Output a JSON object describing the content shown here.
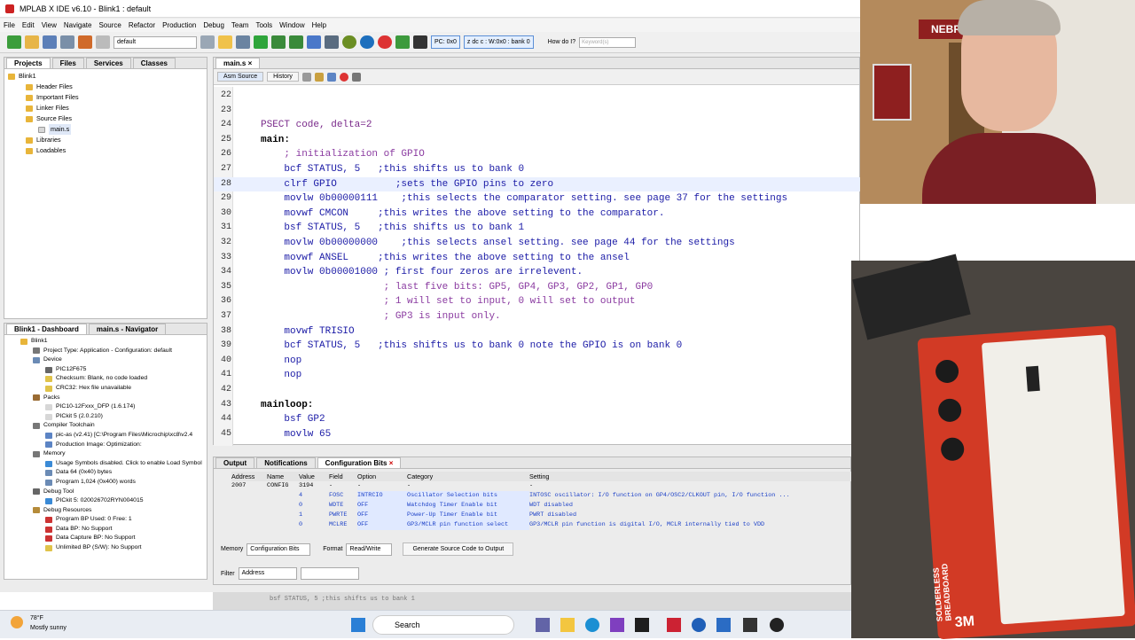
{
  "window": {
    "title": "MPLAB X IDE v6.10 - Blink1 : default"
  },
  "menu": [
    "File",
    "Edit",
    "View",
    "Navigate",
    "Source",
    "Refactor",
    "Production",
    "Debug",
    "Team",
    "Tools",
    "Window",
    "Help"
  ],
  "toolbar": {
    "config_value": "default",
    "pc": "PC: 0x0",
    "status": "z dc c : W:0x0 : bank 0",
    "howdoi": "How do I?",
    "search_placeholder": "Keyword(s)"
  },
  "projects": {
    "tabs": [
      "Projects",
      "Files",
      "Services",
      "Classes"
    ],
    "tree": [
      "Blink1",
      "Header Files",
      "Important Files",
      "Linker Files",
      "Source Files",
      "main.s",
      "Libraries",
      "Loadables"
    ]
  },
  "dashboard": {
    "tabs": [
      "Blink1 - Dashboard",
      "main.s - Navigator"
    ],
    "items": [
      "Blink1",
      "Project Type: Application - Configuration: default",
      "Device",
      "PIC12F675",
      "Checksum: Blank, no code loaded",
      "CRC32: Hex file unavailable",
      "Packs",
      "PIC10-12Fxxx_DFP (1.6.174)",
      "PICkit 5 (2.0.210)",
      "Compiler Toolchain",
      "pic-as (v2.41) [C:\\Program Files\\Microchip\\xc8\\v2.4",
      "Production Image: Optimization:",
      "Memory",
      "Usage Symbols disabled. Click to enable Load Symbol",
      "Data 64 (0x40) bytes",
      "Program 1,024 (0x400) words",
      "Debug Tool",
      "PICkit 5: 020026702RYN004015",
      "Debug Resources",
      "Program BP Used: 0  Free: 1",
      "Data BP: No Support",
      "Data Capture BP: No Support",
      "Unlimited BP (S/W): No Support"
    ]
  },
  "editor": {
    "tab": "main.s",
    "subtabs": [
      "Asm Source",
      "History"
    ],
    "lines": [
      {
        "n": "22",
        "t": ""
      },
      {
        "n": "23",
        "t": ""
      },
      {
        "n": "24",
        "t": "PSECT code, delta=2"
      },
      {
        "n": "25",
        "t": "main:"
      },
      {
        "n": "26",
        "t": "    ; initialization of GPIO"
      },
      {
        "n": "27",
        "t": "    bcf STATUS, 5   ;this shifts us to bank 0"
      },
      {
        "n": "28",
        "t": "    clrf GPIO          ;sets the GPIO pins to zero"
      },
      {
        "n": "29",
        "t": "    movlw 0b00000111    ;this selects the comparator setting. see page 37 for the settings"
      },
      {
        "n": "30",
        "t": "    movwf CMCON     ;this writes the above setting to the comparator."
      },
      {
        "n": "31",
        "t": "    bsf STATUS, 5   ;this shifts us to bank 1"
      },
      {
        "n": "32",
        "t": "    movlw 0b00000000    ;this selects ansel setting. see page 44 for the settings"
      },
      {
        "n": "33",
        "t": "    movwf ANSEL     ;this writes the above setting to the ansel"
      },
      {
        "n": "34",
        "t": "    movlw 0b00001000 ; first four zeros are irrelevent."
      },
      {
        "n": "35",
        "t": "                     ; last five bits: GP5, GP4, GP3, GP2, GP1, GP0"
      },
      {
        "n": "36",
        "t": "                     ; 1 will set to input, 0 will set to output"
      },
      {
        "n": "37",
        "t": "                     ; GP3 is input only."
      },
      {
        "n": "38",
        "t": "    movwf TRISIO"
      },
      {
        "n": "39",
        "t": "    bcf STATUS, 5   ;this shifts us to bank 0 note the GPIO is on bank 0"
      },
      {
        "n": "40",
        "t": "    nop"
      },
      {
        "n": "41",
        "t": "    nop"
      },
      {
        "n": "42",
        "t": ""
      },
      {
        "n": "43",
        "t": "mainloop:"
      },
      {
        "n": "44",
        "t": "    bsf GP2"
      },
      {
        "n": "45",
        "t": "    movlw 65"
      }
    ]
  },
  "bottom": {
    "tabs": [
      "Output",
      "Notifications",
      "Configuration Bits"
    ],
    "headers": [
      "Address",
      "Name",
      "Value",
      "Field",
      "Option",
      "Category",
      "Setting"
    ],
    "rows": [
      [
        "2007",
        "CONFIG",
        "3194",
        "-",
        "-",
        "-",
        "-"
      ],
      [
        "",
        "",
        "4",
        "FOSC",
        "INTRCIO",
        "Oscillator Selection bits",
        "INTOSC oscillator: I/O function on GP4/OSC2/CLKOUT pin, I/O function ..."
      ],
      [
        "",
        "",
        "0",
        "WDTE",
        "OFF",
        "Watchdog Timer Enable bit",
        "WDT disabled"
      ],
      [
        "",
        "",
        "1",
        "PWRTE",
        "OFF",
        "Power-Up Timer Enable bit",
        "PWRT disabled"
      ],
      [
        "",
        "",
        "0",
        "MCLRE",
        "OFF",
        "GP3/MCLR pin function select",
        "GP3/MCLR pin function is digital I/O, MCLR internally tied to VDD"
      ]
    ],
    "memory_label": "Memory",
    "memory_value": "Configuration Bits",
    "format_label": "Format",
    "format_value": "Read/Write",
    "generate_button": "Generate Source Code to Output",
    "filter_label": "Filter",
    "filter_value": "Address"
  },
  "ghost": {
    "text": "bsf STATUS, 5   ;this shifts us to bank 1"
  },
  "taskbar": {
    "weather_temp": "78°F",
    "weather_desc": "Mostly sunny",
    "search": "Search"
  },
  "photo": {
    "sign": "NEBRA",
    "board_brand": "3M",
    "board_label": "SOLDERLESS BREADBOARD"
  }
}
